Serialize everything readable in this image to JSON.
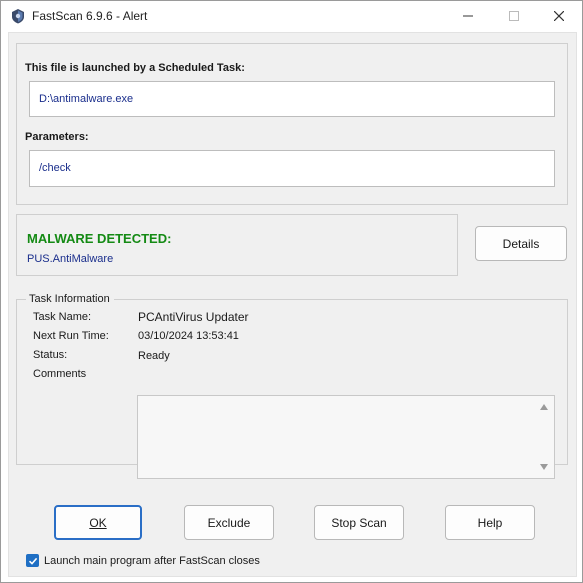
{
  "window": {
    "title": "FastScan 6.9.6 - Alert",
    "controls": {
      "minimize": "minimize",
      "maximize": "maximize",
      "close": "close"
    }
  },
  "file_section": {
    "launched_label": "This file is launched by a Scheduled Task:",
    "path_value": "D:\\antimalware.exe",
    "parameters_label": "Parameters:",
    "parameters_value": "/check"
  },
  "malware_section": {
    "heading": "MALWARE DETECTED:",
    "name": "PUS.AntiMalware",
    "heading_color": "#148a14"
  },
  "details_button_label": "Details",
  "task_info": {
    "legend": "Task Information",
    "rows": [
      {
        "label": "Task Name:",
        "value": "PCAntiVirus Updater"
      },
      {
        "label": "Next Run Time:",
        "value": "03/10/2024 13:53:41"
      },
      {
        "label": "Status:",
        "value": "Ready"
      }
    ],
    "comments_label": "Comments",
    "comments_value": ""
  },
  "buttons": {
    "ok": "OK",
    "exclude": "Exclude",
    "stop_scan": "Stop Scan",
    "help": "Help"
  },
  "launch_checkbox": {
    "label": "Launch main program after FastScan closes",
    "checked": true
  },
  "icons": [
    "app-icon",
    "minimize-icon",
    "maximize-icon",
    "close-icon",
    "scroll-up-icon",
    "scroll-down-icon",
    "checkmark-icon"
  ],
  "colors": {
    "accent": "#1f6fc4",
    "link_text": "#1a2e8c",
    "detected": "#148a14"
  }
}
